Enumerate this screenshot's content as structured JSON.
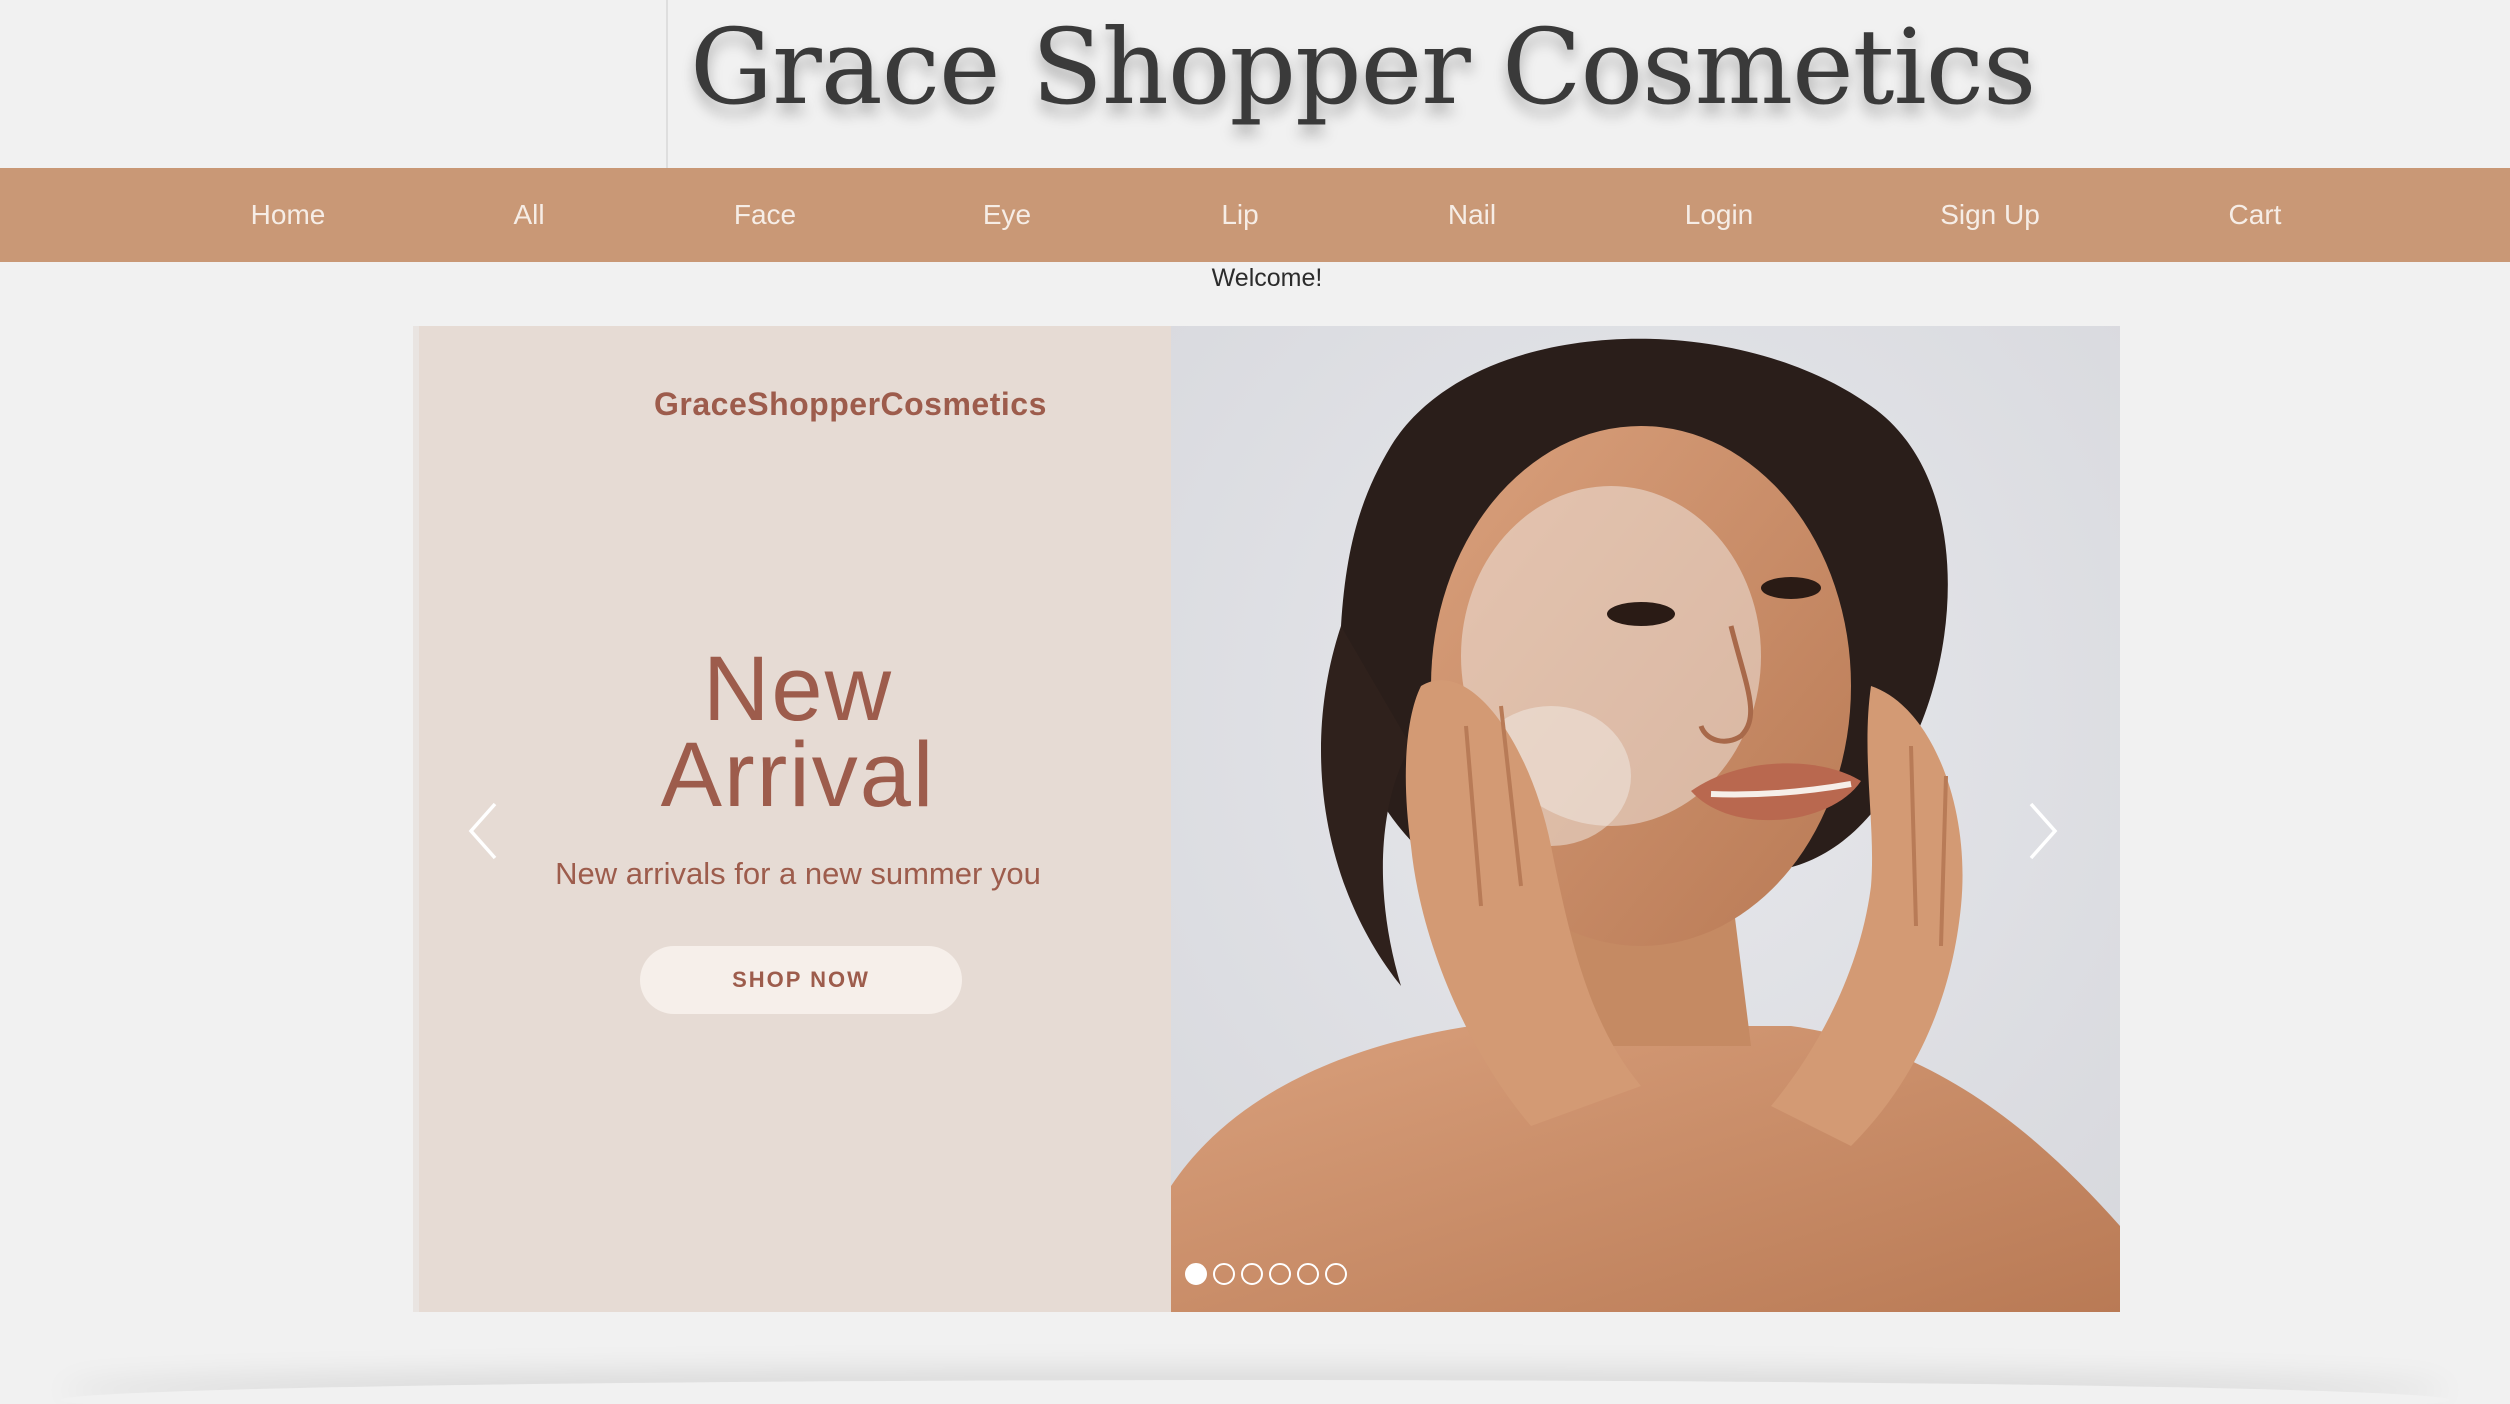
{
  "header": {
    "site_title": "Grace Shopper Cosmetics"
  },
  "nav": {
    "items": [
      {
        "label": "Home"
      },
      {
        "label": "All"
      },
      {
        "label": "Face"
      },
      {
        "label": "Eye"
      },
      {
        "label": "Lip"
      },
      {
        "label": "Nail"
      },
      {
        "label": "Login"
      },
      {
        "label": "Sign Up"
      },
      {
        "label": "Cart"
      }
    ]
  },
  "welcome_text": "Welcome!",
  "carousel": {
    "slide": {
      "brand": "GraceShopperCosmetics",
      "heading_line1": "New",
      "heading_line2": "Arrival",
      "subheading": "New arrivals for a new summer you",
      "button_label": "SHOP NOW"
    },
    "slide_count": 6,
    "active_index": 0
  },
  "colors": {
    "nav_bg": "#c99876",
    "slide_left_bg": "#e6dbd4",
    "accent_text": "#9d5c4c",
    "page_bg": "#f1f1f1"
  },
  "icons": {
    "prev": "chevron-left-icon",
    "next": "chevron-right-icon"
  }
}
